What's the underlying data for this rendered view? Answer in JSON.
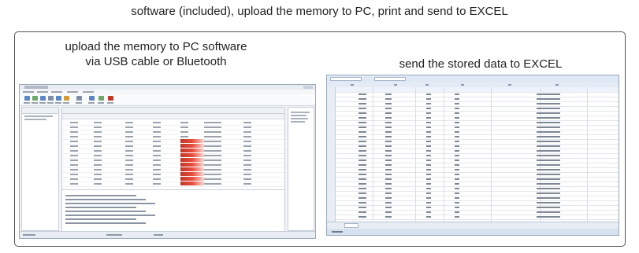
{
  "heading": "software (included), upload the memory to PC, print and send to EXCEL",
  "left_panel": {
    "caption_line1": "upload the memory to PC software",
    "caption_line2": "via USB cable or Bluetooth"
  },
  "right_panel": {
    "caption": "send the stored data to EXCEL"
  },
  "colors": {
    "frame_border": "#555555",
    "window_chrome": "#e8edf3",
    "highlight_red": "#e74c3c",
    "excel_header": "#dfe8f5"
  }
}
